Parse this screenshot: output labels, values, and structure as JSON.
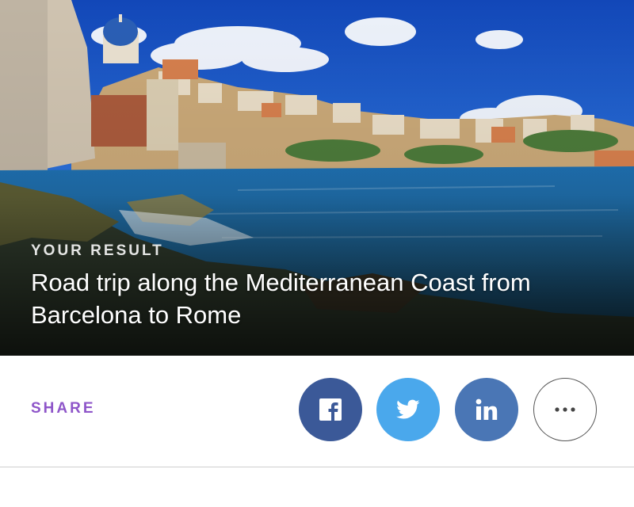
{
  "hero": {
    "eyebrow": "YOUR RESULT",
    "headline": "Road trip along the Mediterranean Coast from Barcelona to Rome",
    "image_subject": "coastal-town-photo"
  },
  "share": {
    "label": "SHARE",
    "buttons": [
      {
        "name": "facebook",
        "icon": "facebook-icon",
        "color": "#3b5998"
      },
      {
        "name": "twitter",
        "icon": "twitter-icon",
        "color": "#4aa8ec"
      },
      {
        "name": "linkedin",
        "icon": "linkedin-icon",
        "color": "#4a76b5"
      },
      {
        "name": "more",
        "icon": "more-dots-icon",
        "color": "#ffffff"
      }
    ],
    "label_color": "#8e55c9"
  }
}
